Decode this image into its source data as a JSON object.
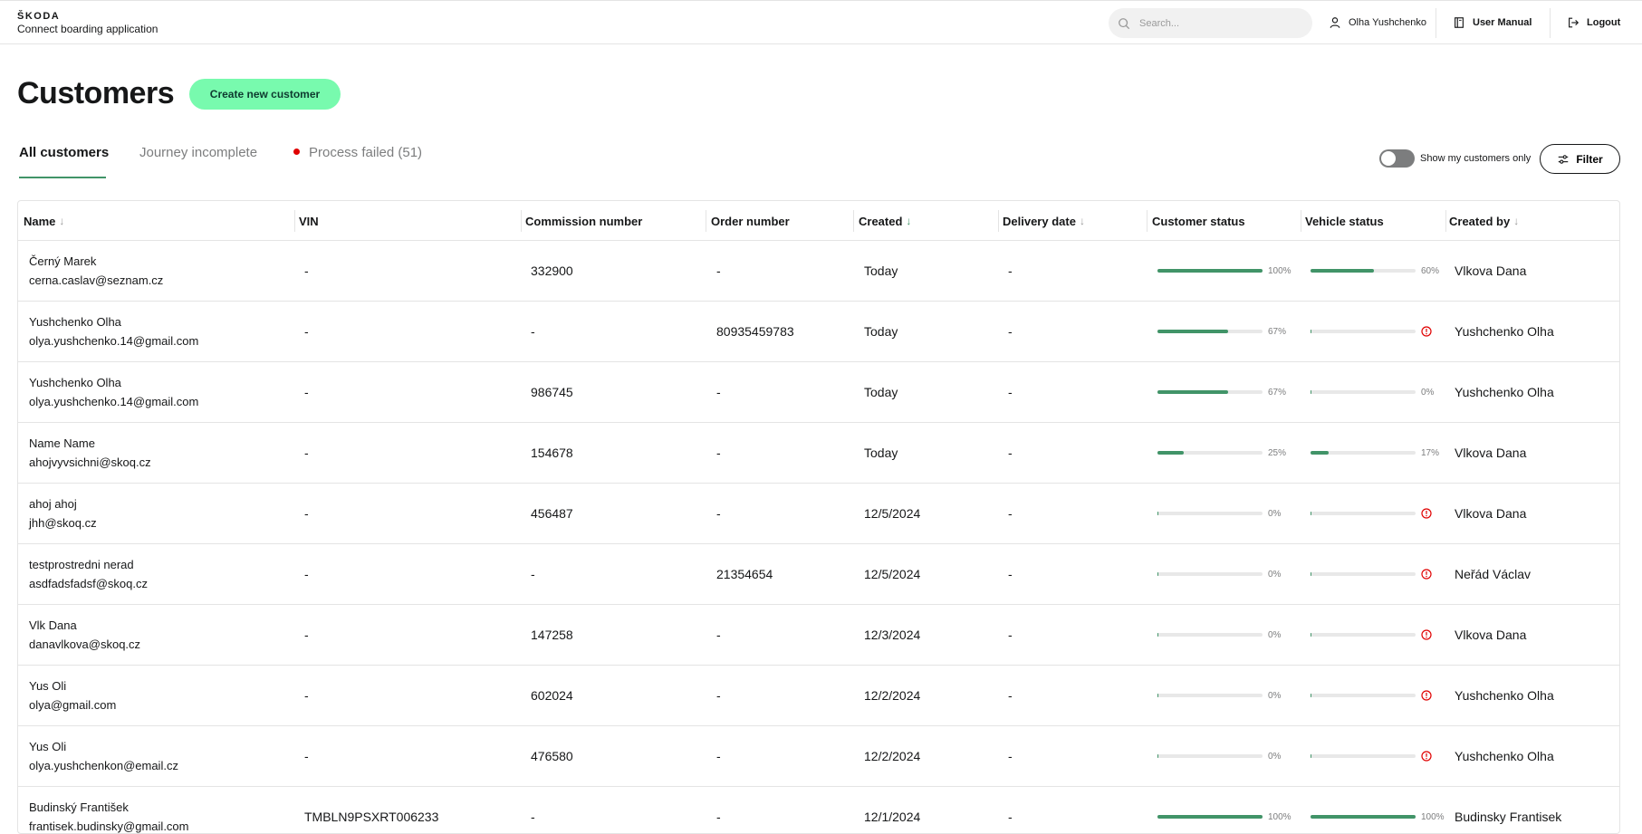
{
  "brand": {
    "logo": "ŠKODA",
    "app": "Connect boarding application"
  },
  "search": {
    "placeholder": "Search..."
  },
  "topnav": {
    "user": "Olha Yushchenko",
    "manual": "User Manual",
    "logout": "Logout"
  },
  "page": {
    "title": "Customers",
    "create_label": "Create new customer"
  },
  "tabs": [
    {
      "label": "All customers",
      "active": true
    },
    {
      "label": "Journey incomplete"
    },
    {
      "label": "Process failed (51)"
    }
  ],
  "toggle": {
    "label": "Show my customers only",
    "on": false
  },
  "filter": {
    "label": "Filter"
  },
  "colors": {
    "accent": "#419468",
    "button": "#78faae",
    "error": "#e00000"
  },
  "columns": [
    {
      "label": "Name",
      "sort": "arrow-down"
    },
    {
      "label": "VIN"
    },
    {
      "label": "Commission number"
    },
    {
      "label": "Order number"
    },
    {
      "label": "Created",
      "sort": "arrow-down-active"
    },
    {
      "label": "Delivery date",
      "sort": "arrow-down"
    },
    {
      "label": "Customer status"
    },
    {
      "label": "Vehicle status"
    },
    {
      "label": "Created by",
      "sort": "arrow-down"
    }
  ],
  "rows": [
    {
      "name": "Černý Marek",
      "email": "cerna.caslav@seznam.cz",
      "vin": "-",
      "commission": "332900",
      "order": "-",
      "created": "Today",
      "delivery": "-",
      "cust_pct": 100,
      "cust_label": "100%",
      "veh_pct": 60,
      "veh_label": "60%",
      "veh_error": false,
      "created_by": "Vlkova Dana"
    },
    {
      "name": "Yushchenko Olha",
      "email": "olya.yushchenko.14@gmail.com",
      "vin": "-",
      "commission": "-",
      "order": "80935459783",
      "created": "Today",
      "delivery": "-",
      "cust_pct": 67,
      "cust_label": "67%",
      "veh_pct": 0,
      "veh_label": "",
      "veh_error": true,
      "created_by": "Yushchenko Olha"
    },
    {
      "name": "Yushchenko Olha",
      "email": "olya.yushchenko.14@gmail.com",
      "vin": "-",
      "commission": "986745",
      "order": "-",
      "created": "Today",
      "delivery": "-",
      "cust_pct": 67,
      "cust_label": "67%",
      "veh_pct": 0,
      "veh_label": "0%",
      "veh_error": false,
      "created_by": "Yushchenko Olha"
    },
    {
      "name": "Name Name",
      "email": "ahojvyvsichni@skoq.cz",
      "vin": "-",
      "commission": "154678",
      "order": "-",
      "created": "Today",
      "delivery": "-",
      "cust_pct": 25,
      "cust_label": "25%",
      "veh_pct": 17,
      "veh_label": "17%",
      "veh_error": false,
      "created_by": "Vlkova Dana"
    },
    {
      "name": "ahoj ahoj",
      "email": "jhh@skoq.cz",
      "vin": "-",
      "commission": "456487",
      "order": "-",
      "created": "12/5/2024",
      "delivery": "-",
      "cust_pct": 0,
      "cust_label": "0%",
      "veh_pct": 0,
      "veh_label": "",
      "veh_error": true,
      "created_by": "Vlkova Dana"
    },
    {
      "name": "testprostredni nerad",
      "email": "asdfadsfadsf@skoq.cz",
      "vin": "-",
      "commission": "-",
      "order": "21354654",
      "created": "12/5/2024",
      "delivery": "-",
      "cust_pct": 0,
      "cust_label": "0%",
      "veh_pct": 0,
      "veh_label": "",
      "veh_error": true,
      "created_by": "Neřád Václav"
    },
    {
      "name": "Vlk Dana",
      "email": "danavlkova@skoq.cz",
      "vin": "-",
      "commission": "147258",
      "order": "-",
      "created": "12/3/2024",
      "delivery": "-",
      "cust_pct": 0,
      "cust_label": "0%",
      "veh_pct": 0,
      "veh_label": "",
      "veh_error": true,
      "created_by": "Vlkova Dana"
    },
    {
      "name": "Yus Oli",
      "email": "olya@gmail.com",
      "vin": "-",
      "commission": "602024",
      "order": "-",
      "created": "12/2/2024",
      "delivery": "-",
      "cust_pct": 0,
      "cust_label": "0%",
      "veh_pct": 0,
      "veh_label": "",
      "veh_error": true,
      "created_by": "Yushchenko Olha"
    },
    {
      "name": "Yus Oli",
      "email": "olya.yushchenkon@email.cz",
      "vin": "-",
      "commission": "476580",
      "order": "-",
      "created": "12/2/2024",
      "delivery": "-",
      "cust_pct": 0,
      "cust_label": "0%",
      "veh_pct": 0,
      "veh_label": "",
      "veh_error": true,
      "created_by": "Yushchenko Olha"
    },
    {
      "name": "Budinský František",
      "email": "frantisek.budinsky@gmail.com",
      "vin": "TMBLN9PSXRT006233",
      "commission": "-",
      "order": "-",
      "created": "12/1/2024",
      "delivery": "-",
      "cust_pct": 100,
      "cust_label": "100%",
      "veh_pct": 100,
      "veh_label": "100%",
      "veh_error": false,
      "created_by": "Budinsky Frantisek"
    }
  ]
}
